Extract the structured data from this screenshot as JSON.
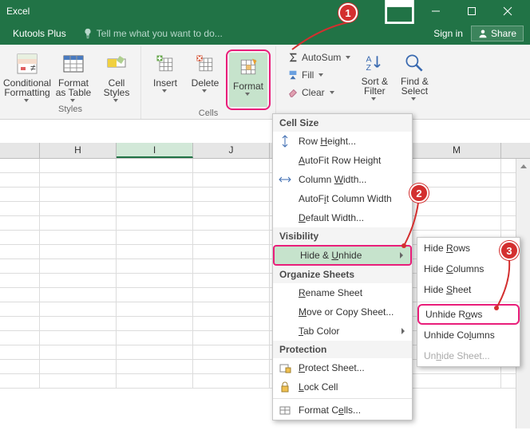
{
  "title": "Excel",
  "bar2": {
    "tab": "Kutools Plus",
    "tell": "Tell me what you want to do...",
    "signin": "Sign in",
    "share": "Share"
  },
  "ribbon": {
    "styles": {
      "conditional": "Conditional Formatting",
      "table": "Format as Table",
      "cellstyles": "Cell Styles",
      "label": "Styles"
    },
    "cells": {
      "insert": "Insert",
      "delete": "Delete",
      "format": "Format",
      "label": "Cells"
    },
    "editing": {
      "autosum": "AutoSum",
      "fill": "Fill",
      "clear": "Clear",
      "sort": "Sort & Filter",
      "find": "Find & Select"
    }
  },
  "cols": {
    "H": "H",
    "I": "I",
    "J": "J",
    "M": "M"
  },
  "menu": {
    "cellsize": "Cell Size",
    "rowheight": "Row Height...",
    "autofitrow": "AutoFit Row Height",
    "colwidth": "Column Width...",
    "autofitcol": "AutoFit Column Width",
    "defwidth": "Default Width...",
    "visibility": "Visibility",
    "hideunhide": "Hide & Unhide",
    "orgsheets": "Organize Sheets",
    "rename": "Rename Sheet",
    "move": "Move or Copy Sheet...",
    "tabcolor": "Tab Color",
    "protection": "Protection",
    "protect": "Protect Sheet...",
    "lock": "Lock Cell",
    "fmtcells": "Format Cells..."
  },
  "submenu": {
    "hiderows": "Hide Rows",
    "hidecols": "Hide Columns",
    "hidesheet": "Hide Sheet",
    "unhiderows": "Unhide Rows",
    "unhidecols": "Unhide Columns",
    "unhidesheet": "Unhide Sheet..."
  },
  "callouts": {
    "c1": "1",
    "c2": "2",
    "c3": "3"
  }
}
